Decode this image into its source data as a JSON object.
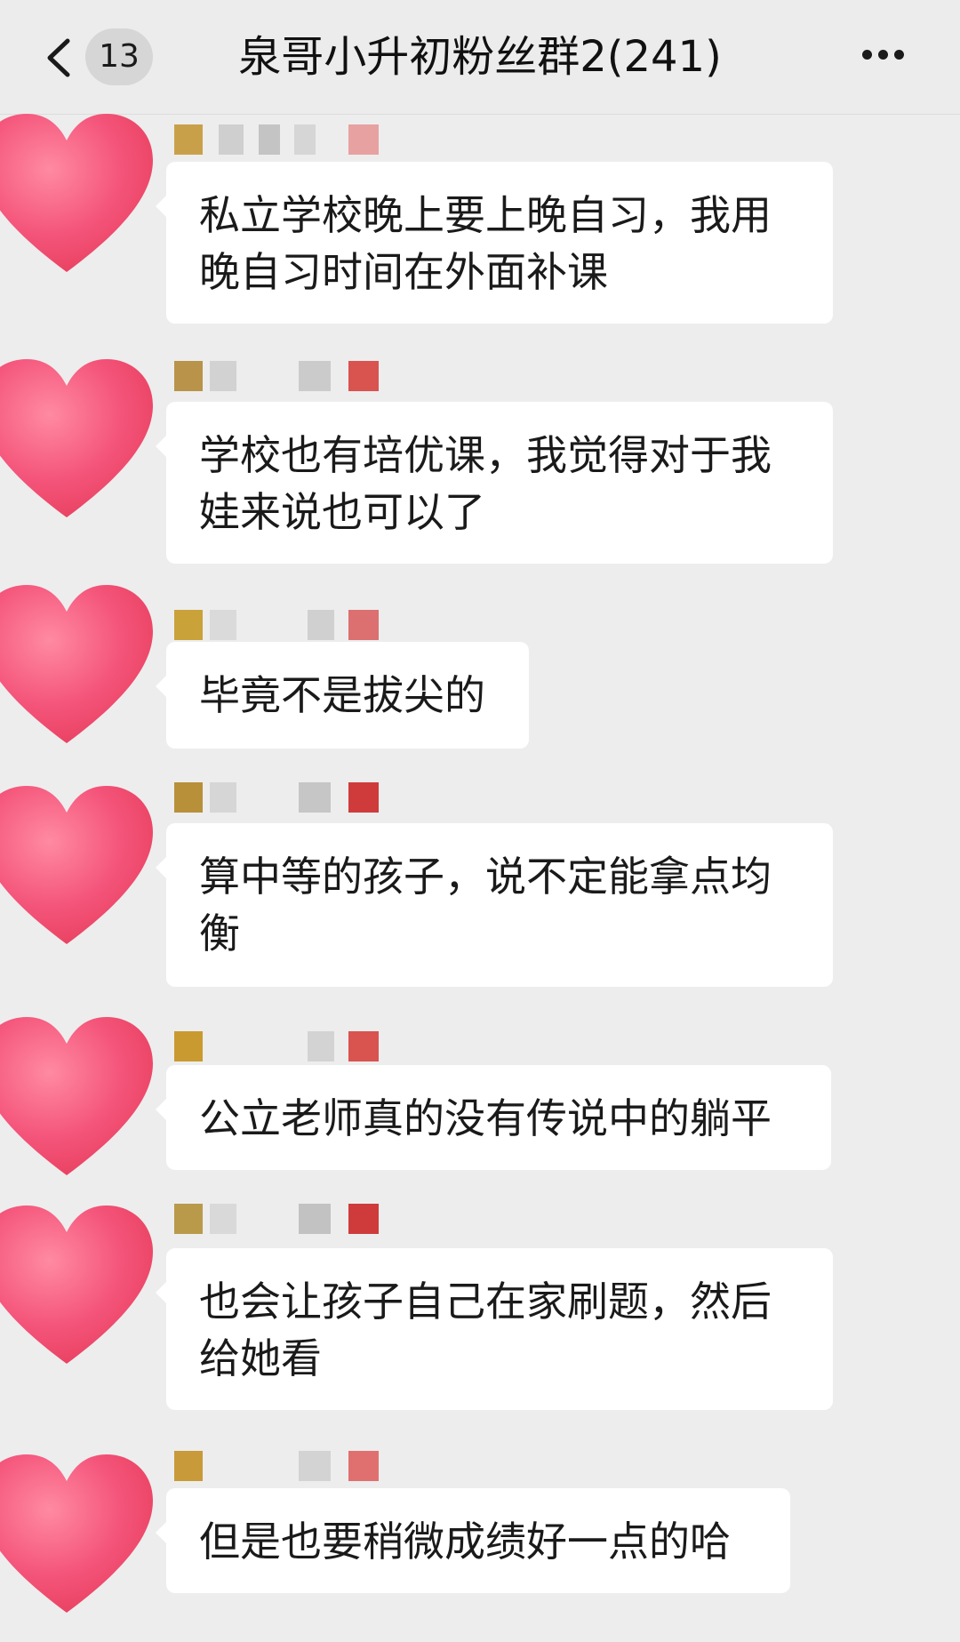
{
  "header": {
    "back_icon": "chevron-left-icon",
    "unread_count": "13",
    "title": "泉哥小升初粉丝群2(241)",
    "more_icon": "more-dots-icon"
  },
  "messages": [
    {
      "sender": "",
      "text": "私立学校晚上要上晚自习，我用晚自习时间在外面补课"
    },
    {
      "sender": "",
      "text": "学校也有培优课，我觉得对于我娃来说也可以了"
    },
    {
      "sender": "",
      "text": "毕竟不是拔尖的"
    },
    {
      "sender": "",
      "text": "算中等的孩子，说不定能拿点均衡"
    },
    {
      "sender": "",
      "text": "公立老师真的没有传说中的躺平"
    },
    {
      "sender": "",
      "text": "也会让孩子自己在家刷题，然后给她看"
    },
    {
      "sender": "",
      "text": "但是也要稍微成绩好一点的哈"
    }
  ],
  "colors": {
    "background": "#ededed",
    "bubble": "#ffffff",
    "heart": "#f4547a",
    "header": "#ececec"
  }
}
